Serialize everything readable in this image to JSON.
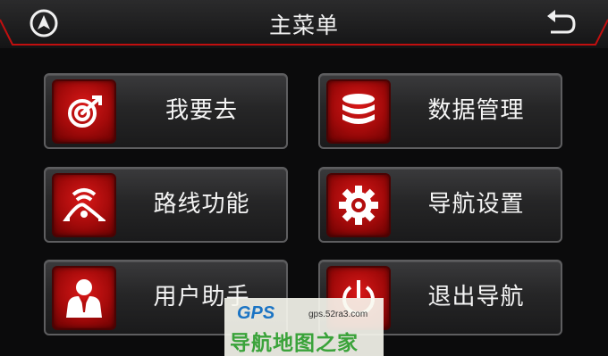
{
  "header": {
    "title": "主菜单",
    "nav_icon": "navigation-arrow-icon",
    "back_icon": "back-arrow-icon"
  },
  "menu": [
    {
      "label": "我要去",
      "icon": "destination-target-icon"
    },
    {
      "label": "数据管理",
      "icon": "database-icon"
    },
    {
      "label": "路线功能",
      "icon": "route-icon"
    },
    {
      "label": "导航设置",
      "icon": "gear-icon"
    },
    {
      "label": "用户助手",
      "icon": "user-assistant-icon"
    },
    {
      "label": "退出导航",
      "icon": "power-icon"
    }
  ],
  "watermark": {
    "brand": "GPS",
    "url": "gps.52ra3.com",
    "name": "导航地图之家"
  },
  "colors": {
    "accent": "#c10f0f",
    "background": "#0b0b0c",
    "watermark_green": "#3aa33a",
    "watermark_blue": "#1b74c4"
  }
}
